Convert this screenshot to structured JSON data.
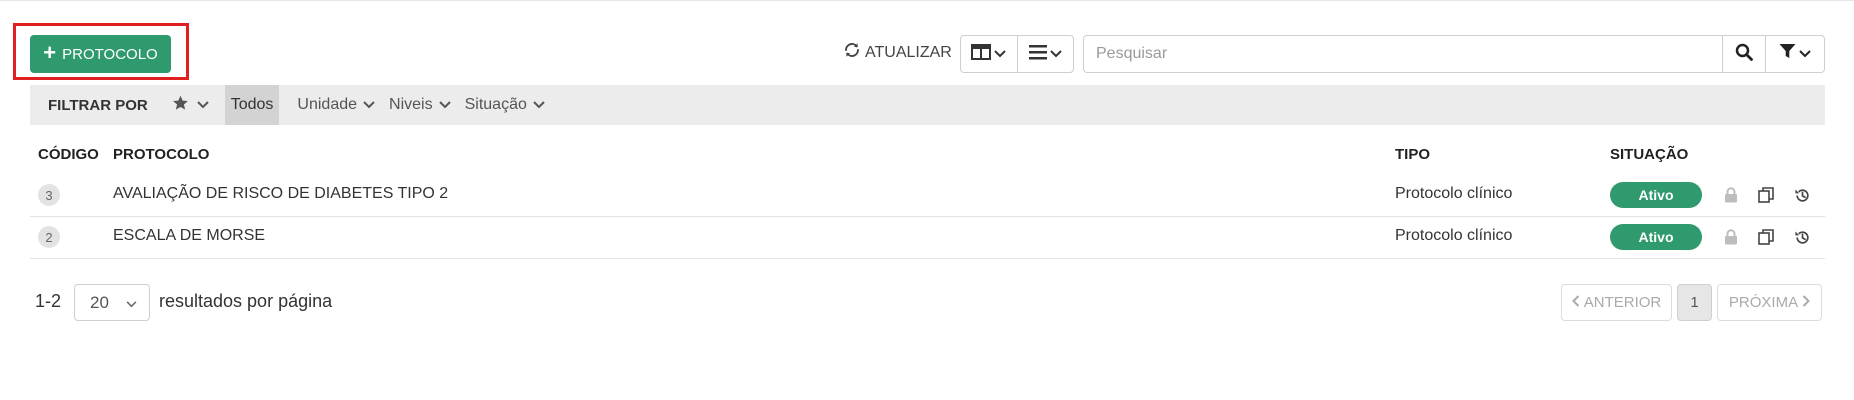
{
  "toolbar": {
    "add_label": "PROTOCOLO",
    "refresh_label": "ATUALIZAR",
    "search_placeholder": "Pesquisar"
  },
  "filter_bar": {
    "label": "FILTRAR POR",
    "chips": [
      "Todos"
    ],
    "dropdowns": [
      "Unidade",
      "Niveis",
      "Situação"
    ]
  },
  "table": {
    "columns": {
      "code": "CÓDIGO",
      "protocol": "PROTOCOLO",
      "type": "TIPO",
      "status": "SITUAÇÃO"
    },
    "rows": [
      {
        "code": "3",
        "protocol": "AVALIAÇÃO DE RISCO DE DIABETES TIPO 2",
        "type": "Protocolo clínico",
        "status": "Ativo"
      },
      {
        "code": "2",
        "protocol": "ESCALA DE MORSE",
        "type": "Protocolo clínico",
        "status": "Ativo"
      }
    ]
  },
  "pagination": {
    "range": "1-2",
    "per_page": "20",
    "per_page_label": "resultados por página",
    "prev_label": "ANTERIOR",
    "current_page": "1",
    "next_label": "PRÓXIMA"
  },
  "colors": {
    "primary_green": "#2e9a6e",
    "highlight_red": "#e02020"
  }
}
